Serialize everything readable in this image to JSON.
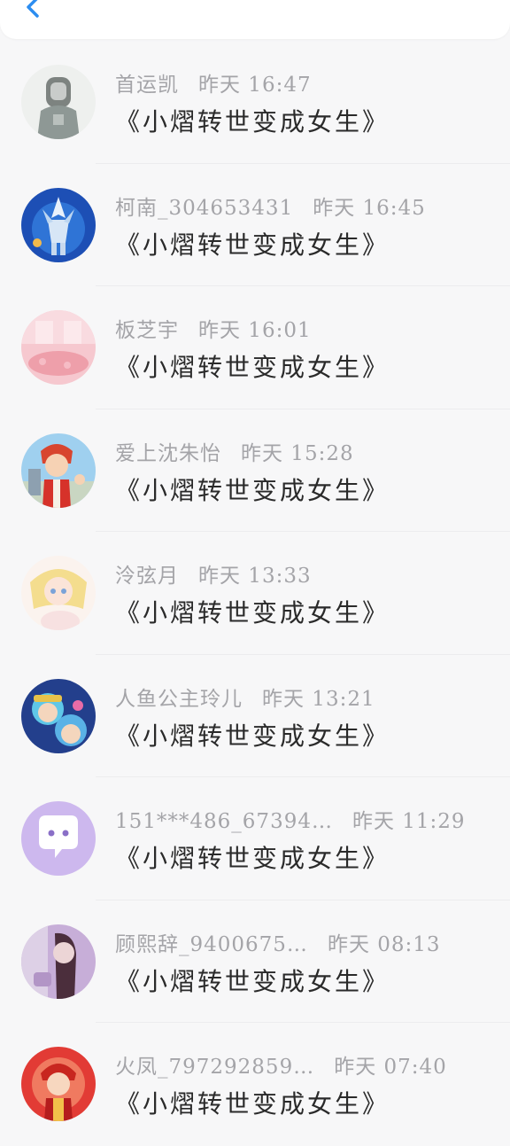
{
  "header": {
    "back_icon": "chevron-left-icon",
    "accent": "#2c8df0"
  },
  "messages": [
    {
      "name": "首运凯",
      "time": "昨天 16:47",
      "text": "《小熠转世变成女生》",
      "avatar": "hoodie-figure"
    },
    {
      "name": "柯南_304653431",
      "time": "昨天 16:45",
      "text": "《小熠转世变成女生》",
      "avatar": "mecha-robot"
    },
    {
      "name": "板芝宇",
      "time": "昨天 16:01",
      "text": "《小熠转世变成女生》",
      "avatar": "pink-room"
    },
    {
      "name": "爱上沈朱怡",
      "time": "昨天 15:28",
      "text": "《小熠转世变成女生》",
      "avatar": "cartoon-boy"
    },
    {
      "name": "泠弦月",
      "time": "昨天 13:33",
      "text": "《小熠转世变成女生》",
      "avatar": "anime-girl"
    },
    {
      "name": "人鱼公主玲儿",
      "time": "昨天 13:21",
      "text": "《小熠转世变成女生》",
      "avatar": "cartoon-duo"
    },
    {
      "name": "151***486_67394…",
      "time": "昨天 11:29",
      "text": "《小熠转世变成女生》",
      "avatar": "default-chat"
    },
    {
      "name": "顾熙辞_9400675…",
      "time": "昨天 08:13",
      "text": "《小熠转世变成女生》",
      "avatar": "purple-photo"
    },
    {
      "name": "火凤_797292859…",
      "time": "昨天 07:40",
      "text": "《小熠转世变成女生》",
      "avatar": "red-cartoon"
    }
  ]
}
